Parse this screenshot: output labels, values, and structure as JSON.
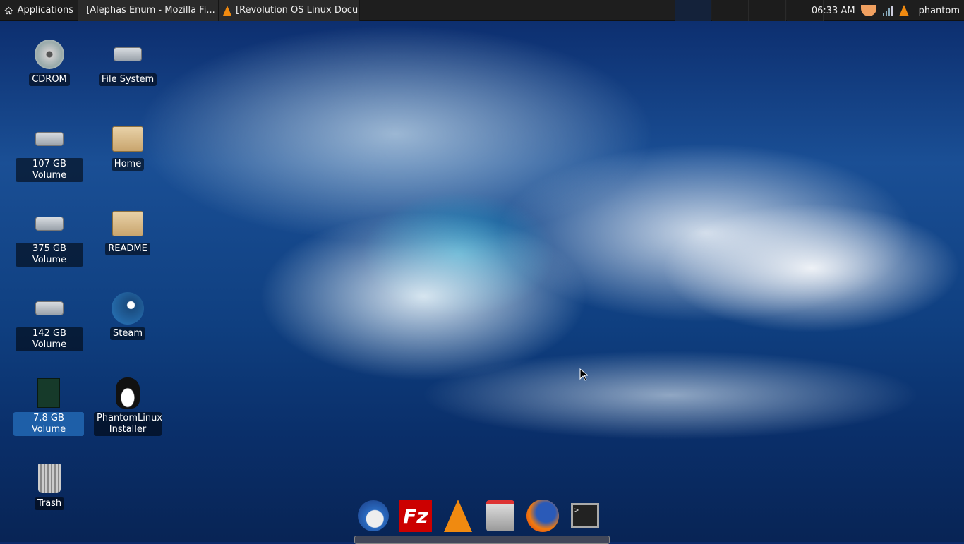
{
  "topbar": {
    "applications_label": "Applications",
    "tasks": [
      {
        "icon": "firefox-icon",
        "label": "[Alephas Enum - Mozilla Fi..."
      },
      {
        "icon": "vlc-icon",
        "label": "[Revolution OS Linux Docu..."
      }
    ],
    "workspaces": 4,
    "active_workspace": 1,
    "clock": "06:33 AM",
    "user": "phantom"
  },
  "desktop": {
    "column1": [
      {
        "label": "CDROM",
        "icon": "cdrom-icon"
      },
      {
        "label": "107 GB Volume",
        "icon": "drive-icon"
      },
      {
        "label": "375 GB Volume",
        "icon": "drive-icon"
      },
      {
        "label": "142 GB Volume",
        "icon": "drive-icon"
      },
      {
        "label": "7.8 GB Volume",
        "icon": "usb-drive-icon",
        "selected": true
      },
      {
        "label": "Trash",
        "icon": "trash-icon"
      }
    ],
    "column2": [
      {
        "label": "File System",
        "icon": "drive-icon"
      },
      {
        "label": "Home",
        "icon": "home-folder-icon"
      },
      {
        "label": "README",
        "icon": "folder-icon"
      },
      {
        "label": "Steam",
        "icon": "steam-icon"
      },
      {
        "label": "PhantomLinux Installer",
        "icon": "tux-icon"
      }
    ]
  },
  "dock": [
    "thunderbird-icon",
    "filezilla-icon",
    "vlc-icon",
    "transmission-icon",
    "firefox-icon",
    "terminal-icon"
  ]
}
